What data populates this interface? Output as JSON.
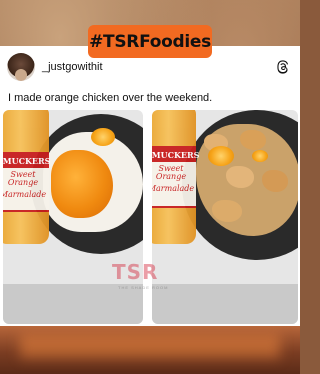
{
  "hashtag": "#TSRFoodies",
  "post": {
    "username": "_justgowithit",
    "caption": "I made orange chicken over the weekend.",
    "avatar_icon": "avatar",
    "platform_icon": "threads-icon"
  },
  "photos": {
    "left": {
      "jar_brand": "SMUCKERS",
      "jar_text_1": "Sweet Orange",
      "jar_text_2": "Marmalade"
    },
    "right": {
      "jar_brand": "SMUCKERS",
      "jar_text_1": "Sweet Orange",
      "jar_text_2": "Marmalade"
    }
  },
  "watermark": "TSR",
  "watermark_sub": "THE SHADE ROOM",
  "colors": {
    "hashtag_bg": "#f26a21",
    "watermark": "#d2283c",
    "jar_label": "#c81e1e"
  }
}
